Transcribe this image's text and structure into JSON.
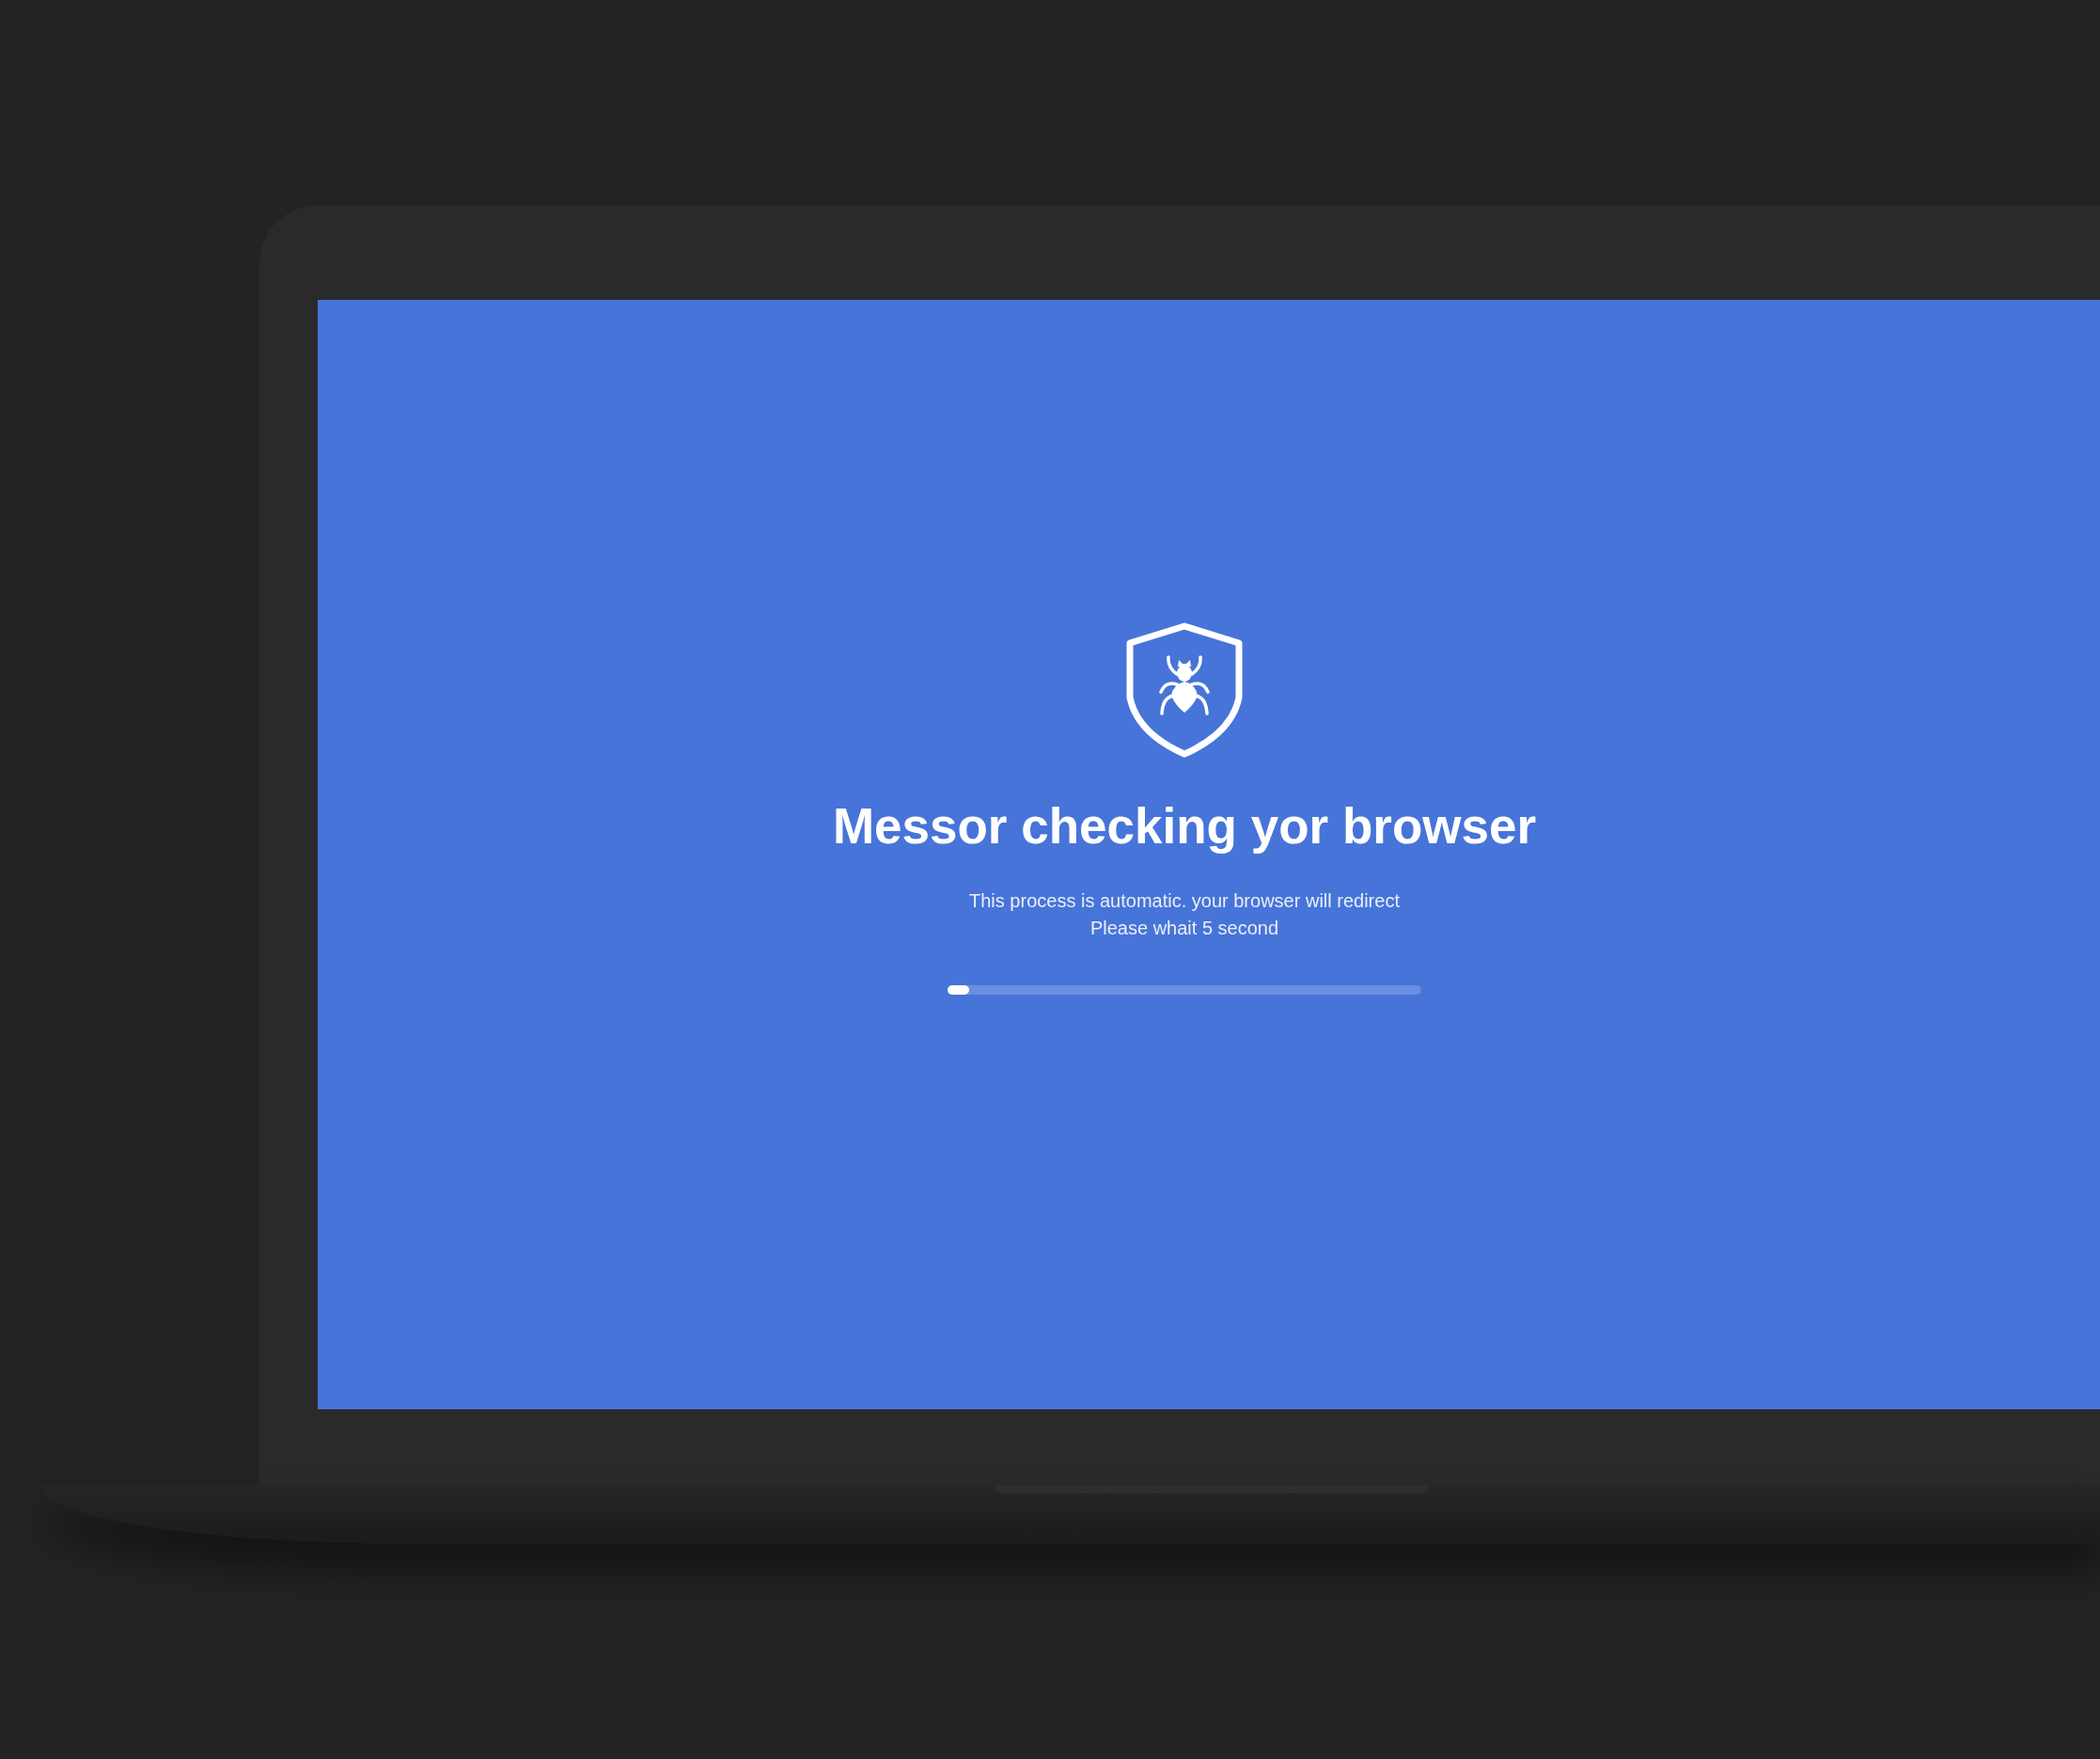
{
  "page": {
    "title": "Messor checking yor browser",
    "message_lines": [
      "This process is automatic. your browser will redirect",
      "Please whait 5 second"
    ],
    "progress": {
      "level": 0.045
    }
  }
}
